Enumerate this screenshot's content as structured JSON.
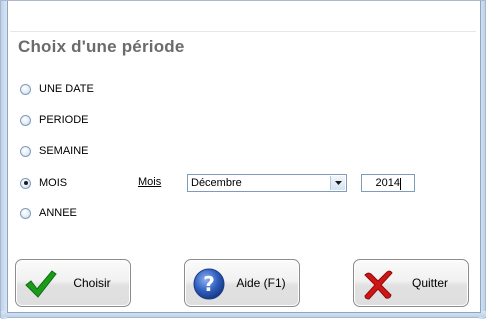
{
  "dialog": {
    "title": "Choix d'une période"
  },
  "period_options": [
    {
      "label": "UNE DATE",
      "checked": false
    },
    {
      "label": "PERIODE",
      "checked": false
    },
    {
      "label": "SEMAINE",
      "checked": false
    },
    {
      "label": "MOIS",
      "checked": true
    },
    {
      "label": "ANNEE",
      "checked": false
    }
  ],
  "month_selector": {
    "label": "Mois",
    "value": "Décembre"
  },
  "year_field": {
    "value": "2014"
  },
  "buttons": {
    "choose": {
      "label": "Choisir",
      "icon": "check-icon",
      "color": "#1a9b1a"
    },
    "help": {
      "label": "Aide (F1)",
      "icon": "help-icon",
      "color": "#2f5fbf"
    },
    "quit": {
      "label": "Quitter",
      "icon": "cross-icon",
      "color": "#d01515"
    }
  }
}
